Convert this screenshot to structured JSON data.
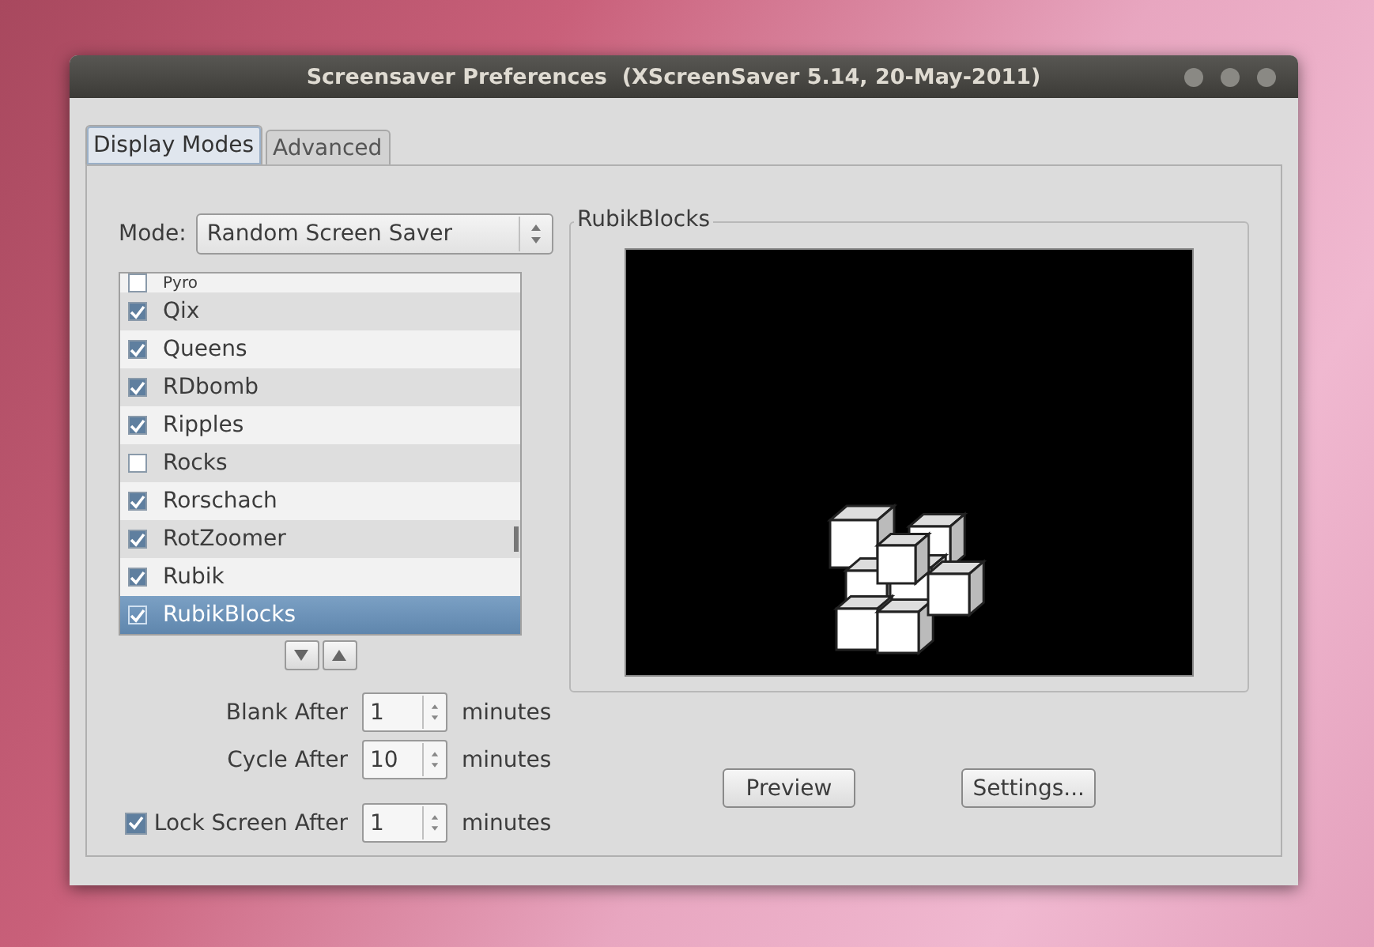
{
  "window": {
    "title": "Screensaver Preferences  (XScreenSaver 5.14, 20-May-2011)"
  },
  "tabs": [
    {
      "label": "Display Modes",
      "selected": true
    },
    {
      "label": "Advanced",
      "selected": false
    }
  ],
  "mode": {
    "label": "Mode:",
    "value": "Random Screen Saver"
  },
  "screensavers": [
    {
      "name": "Pyro",
      "checked": false,
      "selected": false
    },
    {
      "name": "Qix",
      "checked": true,
      "selected": false
    },
    {
      "name": "Queens",
      "checked": true,
      "selected": false
    },
    {
      "name": "RDbomb",
      "checked": true,
      "selected": false
    },
    {
      "name": "Ripples",
      "checked": true,
      "selected": false
    },
    {
      "name": "Rocks",
      "checked": false,
      "selected": false
    },
    {
      "name": "Rorschach",
      "checked": true,
      "selected": false
    },
    {
      "name": "RotZoomer",
      "checked": true,
      "selected": false
    },
    {
      "name": "Rubik",
      "checked": true,
      "selected": false
    },
    {
      "name": "RubikBlocks",
      "checked": true,
      "selected": true
    }
  ],
  "preview": {
    "title": "RubikBlocks"
  },
  "timing": [
    {
      "kind": "plain",
      "label": "Blank After",
      "value": "1",
      "unit": "minutes"
    },
    {
      "kind": "plain",
      "label": "Cycle After",
      "value": "10",
      "unit": "minutes"
    },
    {
      "kind": "checkbox",
      "label": "Lock Screen After",
      "checked": true,
      "value": "1",
      "unit": "minutes"
    }
  ],
  "buttons": [
    "Preview",
    "Settings..."
  ]
}
